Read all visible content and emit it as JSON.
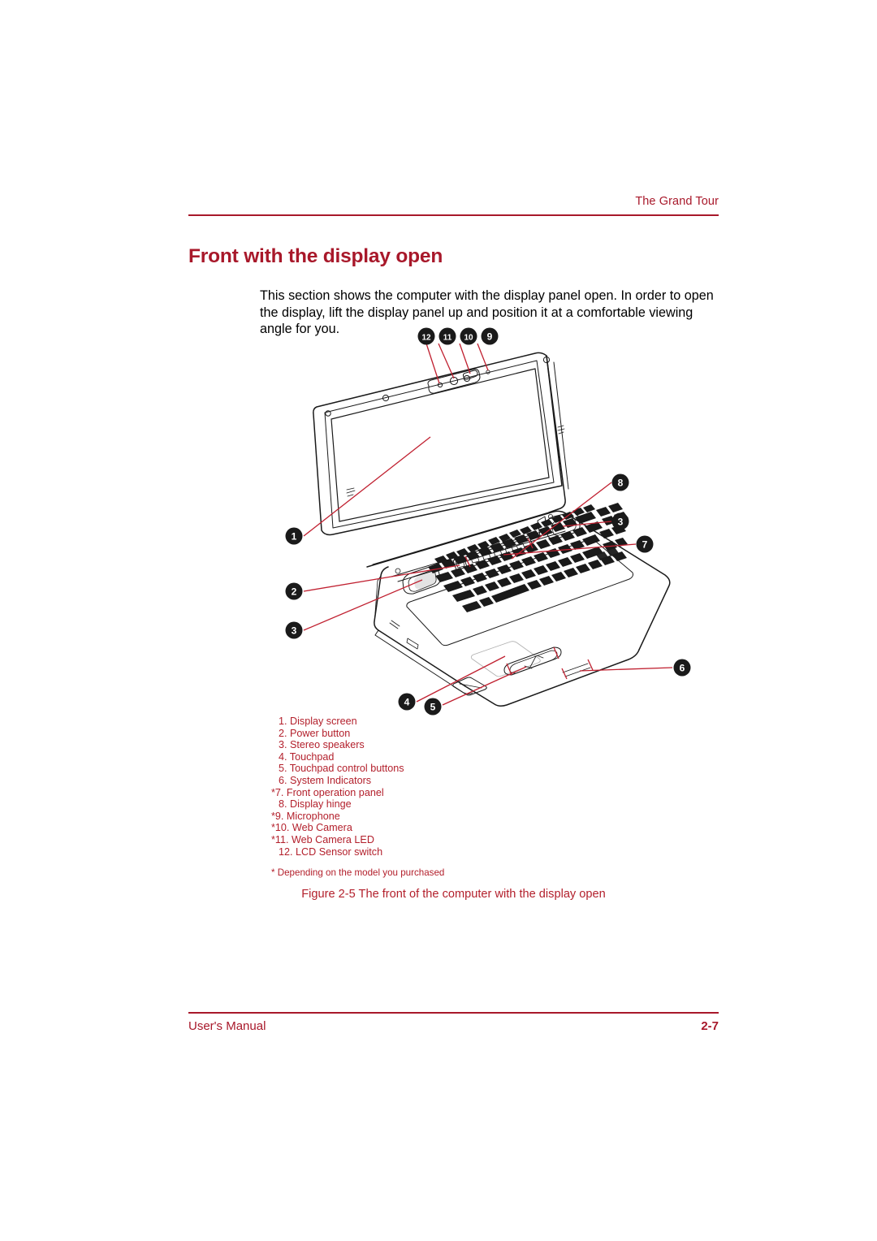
{
  "page": {
    "running_header": "The Grand Tour",
    "section_heading": "Front with the display open",
    "intro_paragraph": "This section shows the computer with the display panel open. In order to open the display, lift the display panel up and position it at a comfortable viewing angle for you.",
    "footer_left": "User's Manual",
    "footer_page_number": "2-7"
  },
  "figure": {
    "caption": "Figure 2-5 The front of the computer with the display open",
    "footnote": "* Depending on the model you purchased",
    "legend": [
      {
        "num": "1.",
        "label": "Display screen",
        "text": "1. Display screen",
        "starred": false
      },
      {
        "num": "2.",
        "label": "Power button",
        "text": "2. Power button",
        "starred": false
      },
      {
        "num": "3.",
        "label": "Stereo speakers",
        "text": "3. Stereo speakers",
        "starred": false
      },
      {
        "num": "4.",
        "label": "Touchpad",
        "text": "4. Touchpad",
        "starred": false
      },
      {
        "num": "5.",
        "label": "Touchpad control buttons",
        "text": "5. Touchpad control buttons",
        "starred": false
      },
      {
        "num": "6.",
        "label": "System Indicators",
        "text": "6. System Indicators",
        "starred": false
      },
      {
        "num": "*7.",
        "label": "Front operation panel",
        "text": "*7. Front operation panel",
        "starred": true
      },
      {
        "num": "8.",
        "label": "Display hinge",
        "text": "8. Display hinge",
        "starred": false
      },
      {
        "num": "*9.",
        "label": "Microphone",
        "text": "*9. Microphone",
        "starred": true
      },
      {
        "num": "*10.",
        "label": "Web Camera",
        "text": "*10. Web Camera",
        "starred": true
      },
      {
        "num": "*11.",
        "label": "Web Camera LED",
        "text": "*11. Web Camera LED",
        "starred": true
      },
      {
        "num": "12.",
        "label": "LCD Sensor switch",
        "text": "12. LCD Sensor switch",
        "starred": false
      }
    ],
    "callouts": [
      {
        "id": "1",
        "label": "1",
        "target": "display-screen"
      },
      {
        "id": "2",
        "label": "2",
        "target": "power-button"
      },
      {
        "id": "3-left",
        "label": "3",
        "target": "stereo-speaker-left"
      },
      {
        "id": "3-right",
        "label": "3",
        "target": "stereo-speaker-right"
      },
      {
        "id": "4",
        "label": "4",
        "target": "touchpad"
      },
      {
        "id": "5",
        "label": "5",
        "target": "touchpad-control-buttons"
      },
      {
        "id": "6",
        "label": "6",
        "target": "system-indicators"
      },
      {
        "id": "7",
        "label": "7",
        "target": "front-operation-panel"
      },
      {
        "id": "8",
        "label": "8",
        "target": "display-hinge"
      },
      {
        "id": "9",
        "label": "9",
        "target": "microphone"
      },
      {
        "id": "10",
        "label": "10",
        "target": "web-camera"
      },
      {
        "id": "11",
        "label": "11",
        "target": "web-camera-led"
      },
      {
        "id": "12",
        "label": "12",
        "target": "lcd-sensor-switch"
      }
    ],
    "illustration_alt": "Line drawing of a notebook computer viewed from the front at an angle with the display panel open"
  },
  "colors": {
    "heading_red": "#a8182a",
    "legend_red": "#b3202c",
    "leader_line_red": "#c02030",
    "body_black": "#000000",
    "line_art_black": "#1a1a1a",
    "page_background": "#ffffff"
  }
}
